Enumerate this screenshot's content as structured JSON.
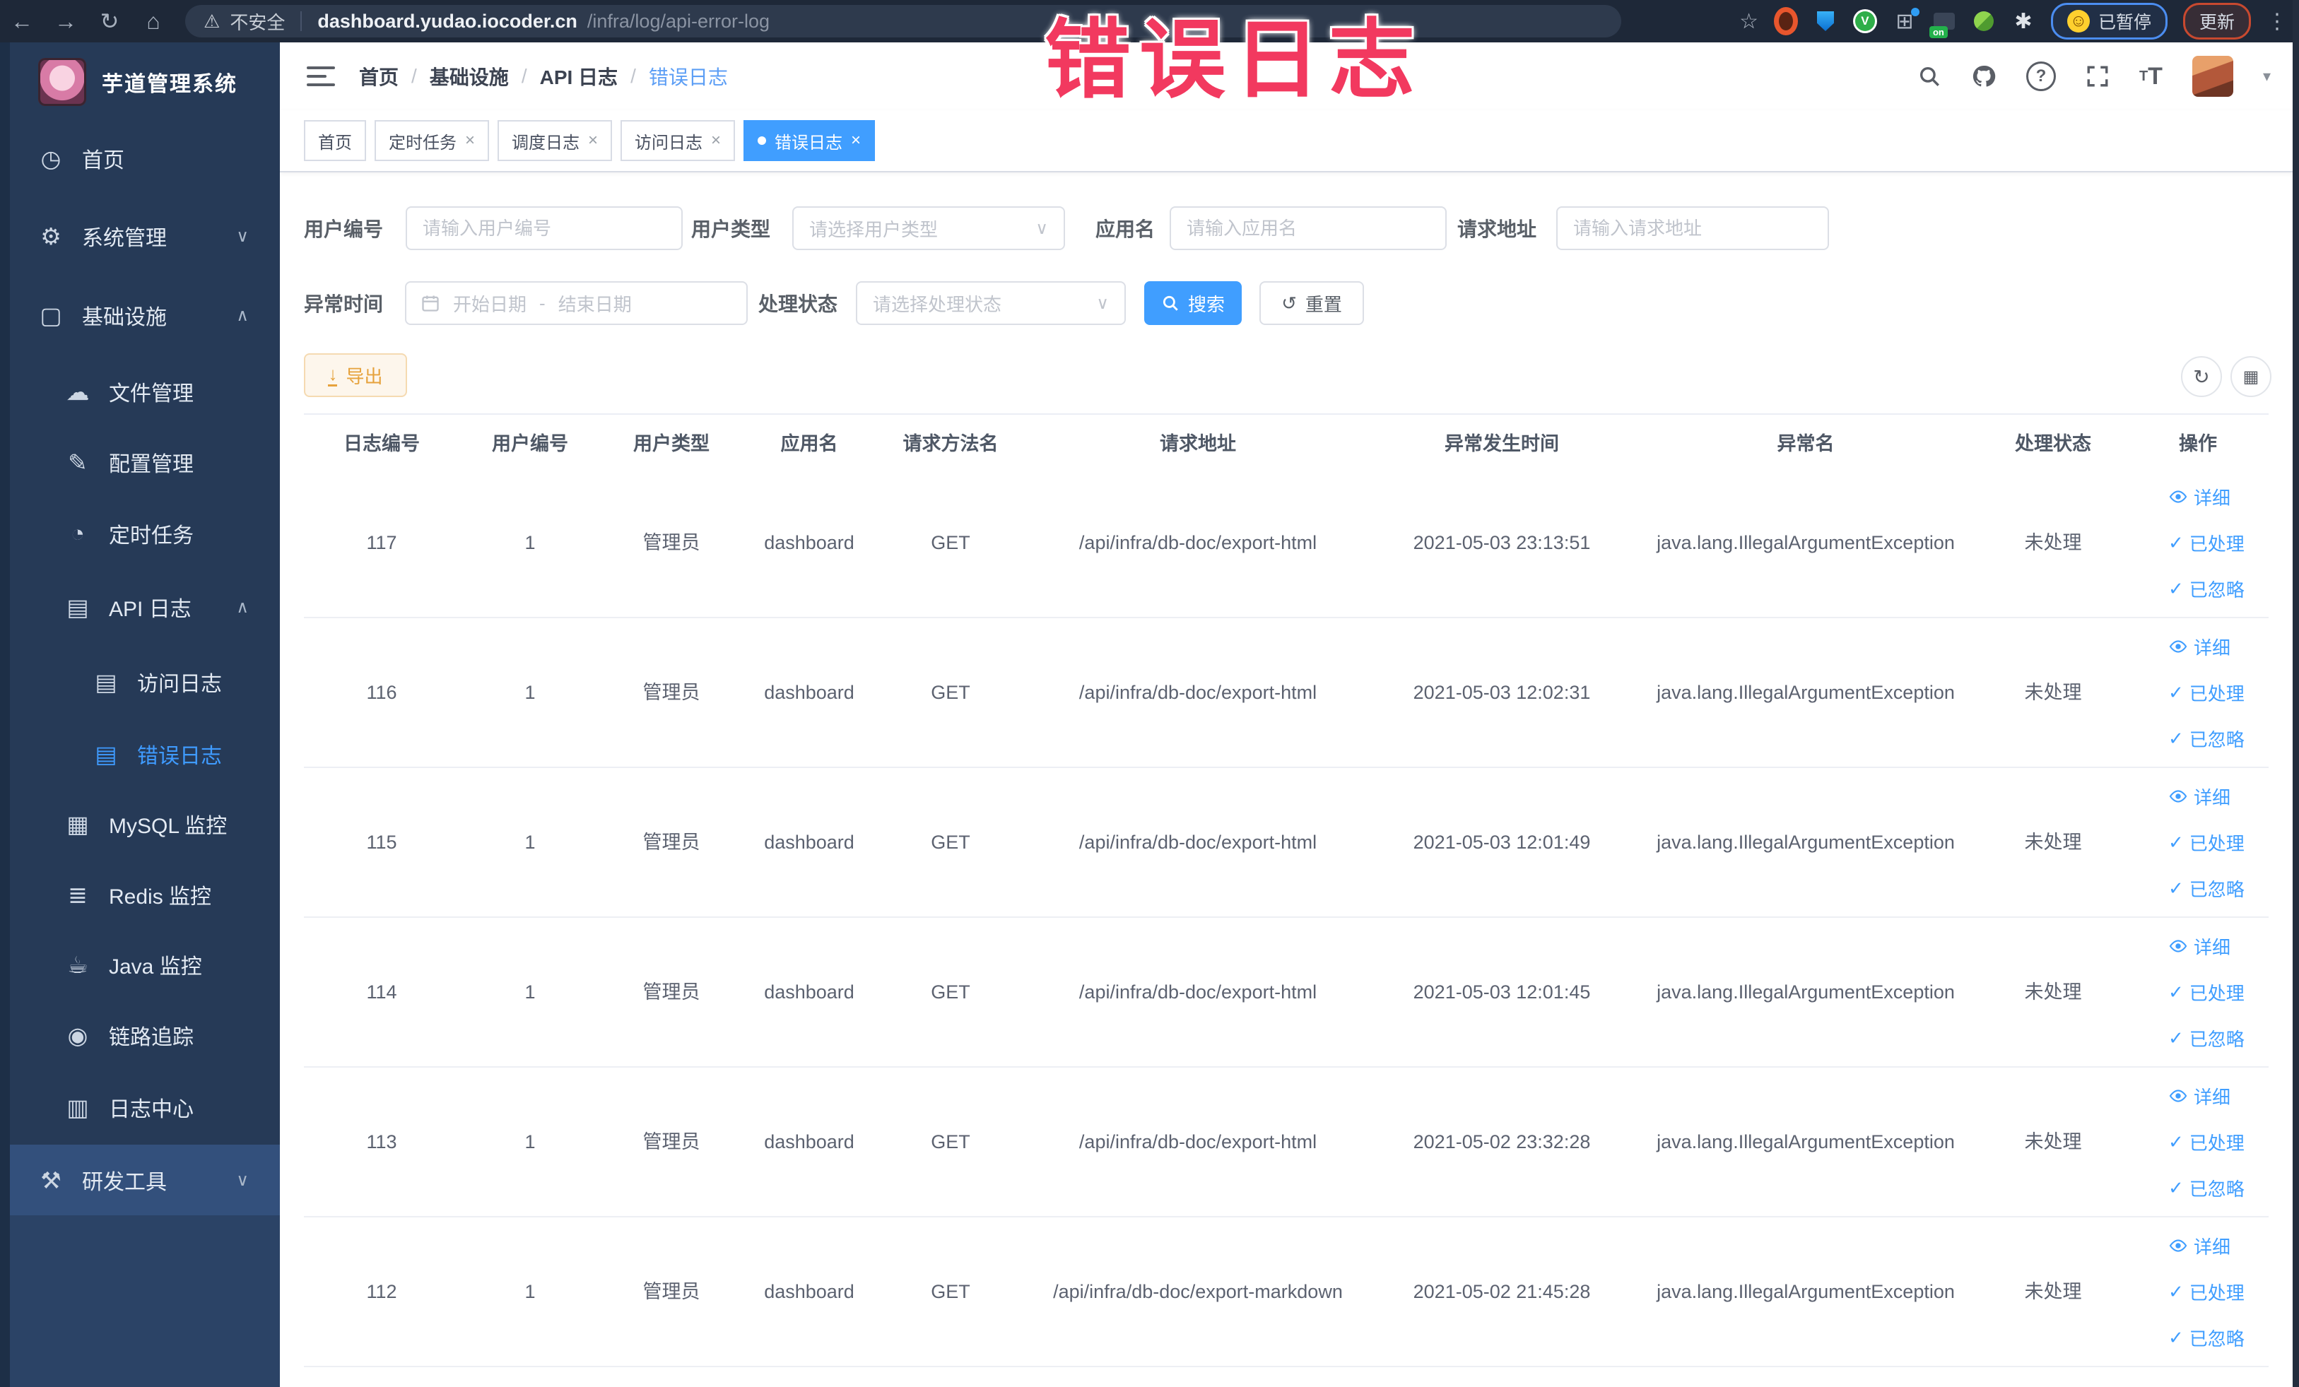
{
  "overlay": {
    "title": "错误日志"
  },
  "colors": {
    "accent": "#409eff",
    "warning": "#e6a23c",
    "overlay_red": "#f2395f",
    "sidebar_bg": "#263a57"
  },
  "browser": {
    "security_label": "不安全",
    "url_host": "dashboard.yudao.iocoder.cn",
    "url_path": "/infra/log/api-error-log",
    "paused_label": "已暂停",
    "update_label": "更新"
  },
  "sidebar": {
    "app_title": "芋道管理系统",
    "items": [
      {
        "label": "首页",
        "icon": "◷"
      },
      {
        "label": "系统管理",
        "icon": "⚙"
      },
      {
        "label": "基础设施",
        "icon": "▢"
      },
      {
        "label": "文件管理",
        "icon": "☁"
      },
      {
        "label": "配置管理",
        "icon": "✎"
      },
      {
        "label": "定时任务",
        "icon": "◔"
      },
      {
        "label": "API 日志",
        "icon": "▤"
      },
      {
        "label": "访问日志",
        "icon": "▤"
      },
      {
        "label": "错误日志",
        "icon": "▤"
      },
      {
        "label": "MySQL 监控",
        "icon": "▦"
      },
      {
        "label": "Redis 监控",
        "icon": "≣"
      },
      {
        "label": "Java 监控",
        "icon": "☕"
      },
      {
        "label": "链路追踪",
        "icon": "◉"
      },
      {
        "label": "日志中心",
        "icon": "▥"
      },
      {
        "label": "研发工具",
        "icon": "⚒"
      }
    ]
  },
  "header": {
    "breadcrumb": [
      "首页",
      "基础设施",
      "API 日志",
      "错误日志"
    ]
  },
  "tabs": [
    {
      "label": "首页"
    },
    {
      "label": "定时任务"
    },
    {
      "label": "调度日志"
    },
    {
      "label": "访问日志"
    },
    {
      "label": "错误日志"
    }
  ],
  "filters": {
    "user_id": {
      "label": "用户编号",
      "placeholder": "请输入用户编号"
    },
    "user_type": {
      "label": "用户类型",
      "placeholder": "请选择用户类型"
    },
    "app_name": {
      "label": "应用名",
      "placeholder": "请输入应用名"
    },
    "request_url": {
      "label": "请求地址",
      "placeholder": "请输入请求地址"
    },
    "exception_time": {
      "label": "异常时间",
      "start_placeholder": "开始日期",
      "separator": "-",
      "end_placeholder": "结束日期"
    },
    "process_status": {
      "label": "处理状态",
      "placeholder": "请选择处理状态"
    },
    "search_label": "搜索",
    "reset_label": "重置"
  },
  "toolbar": {
    "export_label": "导出"
  },
  "table": {
    "columns": [
      "日志编号",
      "用户编号",
      "用户类型",
      "应用名",
      "请求方法名",
      "请求地址",
      "异常发生时间",
      "异常名",
      "处理状态",
      "操作"
    ],
    "row_actions": [
      "详细",
      "已处理",
      "已忽略"
    ],
    "rows": [
      {
        "id": "117",
        "user_id": "1",
        "user_type": "管理员",
        "app": "dashboard",
        "method": "GET",
        "url": "/api/infra/db-doc/export-html",
        "time": "2021-05-03 23:13:51",
        "exception": "java.lang.IllegalArgumentException",
        "status": "未处理"
      },
      {
        "id": "116",
        "user_id": "1",
        "user_type": "管理员",
        "app": "dashboard",
        "method": "GET",
        "url": "/api/infra/db-doc/export-html",
        "time": "2021-05-03 12:02:31",
        "exception": "java.lang.IllegalArgumentException",
        "status": "未处理"
      },
      {
        "id": "115",
        "user_id": "1",
        "user_type": "管理员",
        "app": "dashboard",
        "method": "GET",
        "url": "/api/infra/db-doc/export-html",
        "time": "2021-05-03 12:01:49",
        "exception": "java.lang.IllegalArgumentException",
        "status": "未处理"
      },
      {
        "id": "114",
        "user_id": "1",
        "user_type": "管理员",
        "app": "dashboard",
        "method": "GET",
        "url": "/api/infra/db-doc/export-html",
        "time": "2021-05-03 12:01:45",
        "exception": "java.lang.IllegalArgumentException",
        "status": "未处理"
      },
      {
        "id": "113",
        "user_id": "1",
        "user_type": "管理员",
        "app": "dashboard",
        "method": "GET",
        "url": "/api/infra/db-doc/export-html",
        "time": "2021-05-02 23:32:28",
        "exception": "java.lang.IllegalArgumentException",
        "status": "未处理"
      },
      {
        "id": "112",
        "user_id": "1",
        "user_type": "管理员",
        "app": "dashboard",
        "method": "GET",
        "url": "/api/infra/db-doc/export-markdown",
        "time": "2021-05-02 21:45:28",
        "exception": "java.lang.IllegalArgumentException",
        "status": "未处理"
      }
    ]
  }
}
